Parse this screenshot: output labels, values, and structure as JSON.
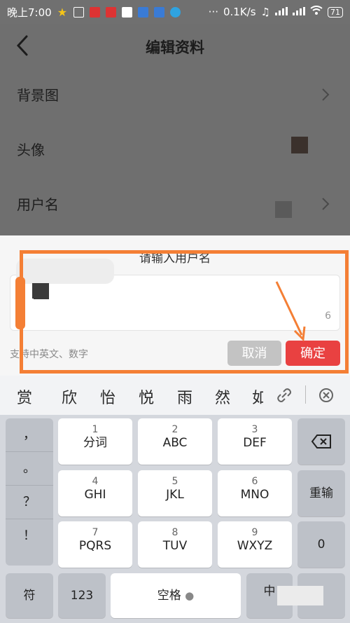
{
  "status_bar": {
    "time": "晚上7:00",
    "speed": "0.1K/s",
    "battery": "71"
  },
  "header": {
    "title": "编辑资料"
  },
  "rows": [
    {
      "label": "背景图"
    },
    {
      "label": "头像"
    },
    {
      "label": "用户名"
    }
  ],
  "dialog": {
    "title": "请输入用户名",
    "counter": "6",
    "hint": "支持中英文、数字",
    "cancel_label": "取消",
    "confirm_label": "确定"
  },
  "keyboard": {
    "candidates": [
      "赏",
      "欣",
      "怡",
      "悦",
      "雨",
      "然",
      "如"
    ],
    "punctuation": [
      "，",
      "。",
      "？",
      "！"
    ],
    "keys": [
      {
        "num": "1",
        "letters": "分词"
      },
      {
        "num": "2",
        "letters": "ABC"
      },
      {
        "num": "3",
        "letters": "DEF"
      },
      {
        "num": "4",
        "letters": "GHI"
      },
      {
        "num": "5",
        "letters": "JKL"
      },
      {
        "num": "6",
        "letters": "MNO"
      },
      {
        "num": "7",
        "letters": "PQRS"
      },
      {
        "num": "8",
        "letters": "TUV"
      },
      {
        "num": "9",
        "letters": "WXYZ"
      }
    ],
    "reinput_label": "重输",
    "zero_label": "0",
    "symbol_label": "符",
    "num_label": "123",
    "space_label": "空格",
    "lang_label": "中"
  },
  "colors": {
    "accent_red": "#e94141",
    "highlight_orange": "#f47f35",
    "overlay_gray": "#6f6f6f"
  }
}
